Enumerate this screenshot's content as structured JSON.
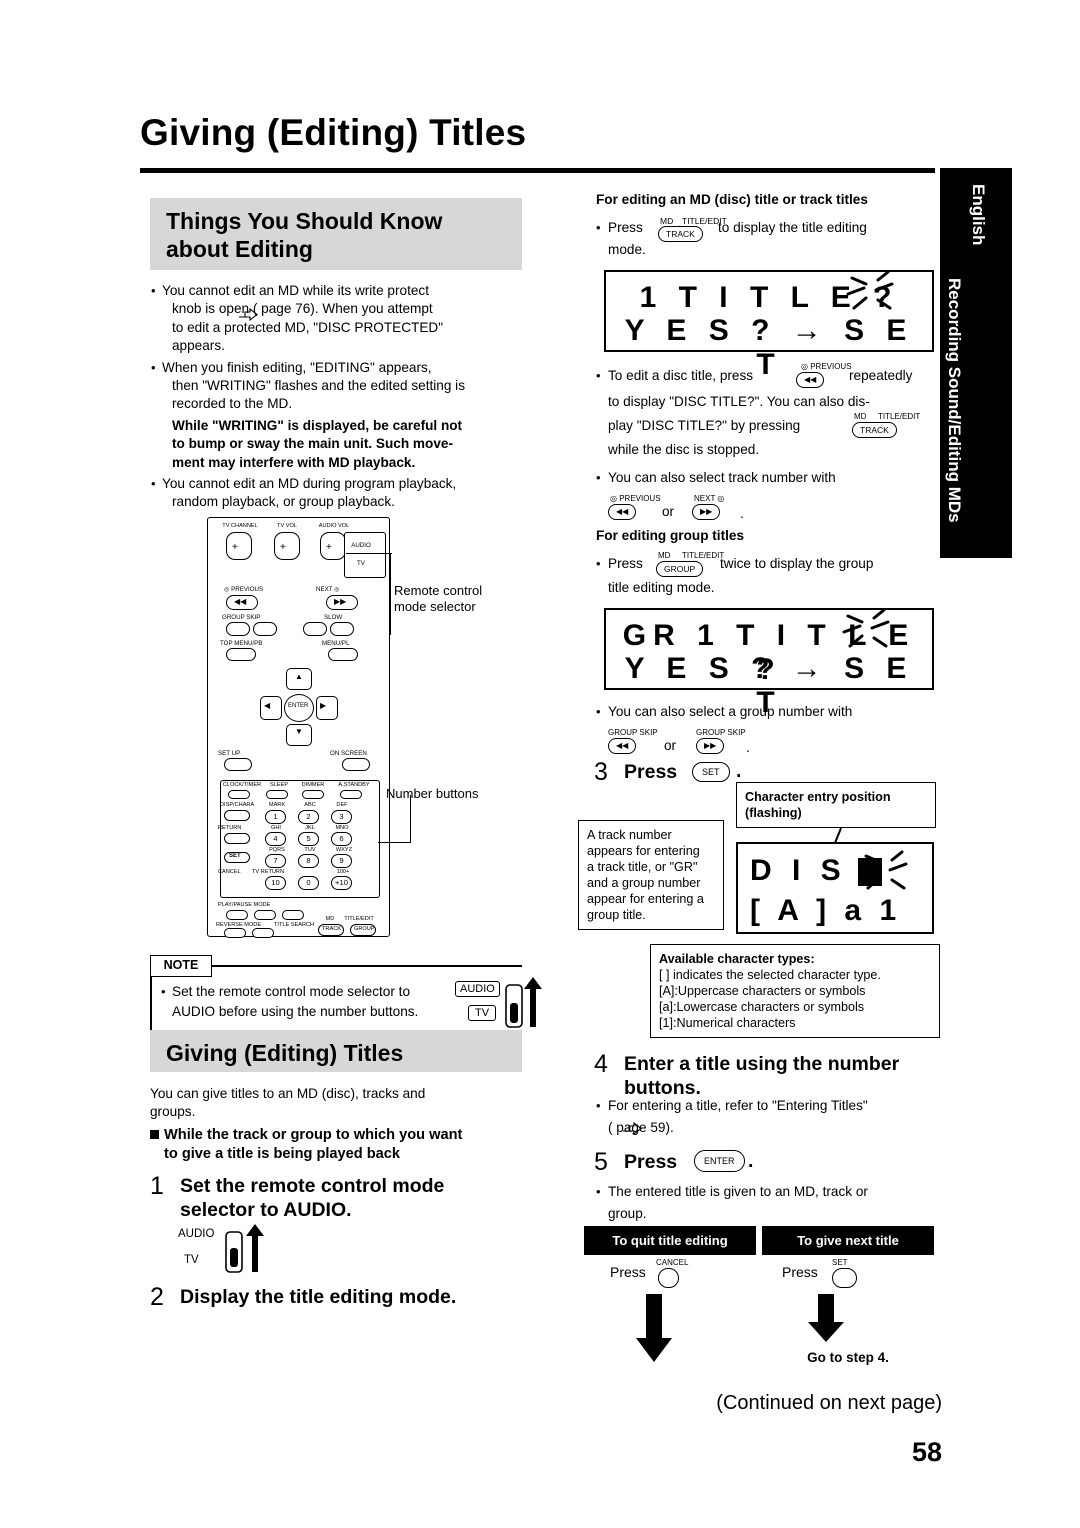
{
  "page": {
    "title": "Giving (Editing) Titles",
    "number": "58",
    "continued": "(Continued on next page)"
  },
  "side_tab": {
    "language": "English",
    "section": "Recording Sound/Editing MDs"
  },
  "left": {
    "heading1_line1": "Things You Should Know",
    "heading1_line2": "about Editing",
    "bullets": [
      "You cannot edit an MD while its write protect",
      "knob is open (       page 76). When you attempt",
      "to edit a protected MD, \"DISC PROTECTED\"",
      "appears.",
      "When you finish editing, \"EDITING\" appears,",
      "then \"WRITING\" flashes and the edited setting is",
      "recorded to the MD.",
      "While \"WRITING\" is displayed, be careful not",
      "to bump or sway the main unit. Such move-",
      "ment may interfere with MD playback.",
      "You cannot edit an MD during program playback,",
      "random playback, or group playback."
    ],
    "callout_remote_mode": "Remote control\nmode selector",
    "callout_number_buttons": "Number buttons",
    "note_tag": "NOTE",
    "note_text_1": "Set the remote control mode selector to",
    "note_text_2": "AUDIO before using the number buttons.",
    "note_audio": "AUDIO",
    "note_tv": "TV",
    "heading2": "Giving (Editing) Titles",
    "intro_1": "You can give titles to an MD (disc), tracks and",
    "intro_2": "groups.",
    "square_line1": "While the track or group to which you want",
    "square_line2": "to give a title is being played back",
    "step1_num": "1",
    "step1_text_1": "Set the remote control mode",
    "step1_text_2": "selector to AUDIO.",
    "step1_audio": "AUDIO",
    "step1_tv": "TV",
    "step2_num": "2",
    "step2_text": "Display the title editing mode."
  },
  "remote": {
    "labels": {
      "tv_channel": "TV CHANNEL",
      "tv_vol": "TV VOL",
      "audio_vol": "AUDIO VOL",
      "audio": "AUDIO",
      "tv": "TV",
      "previous": "PREVIOUS",
      "next": "NEXT",
      "group_skip": "GROUP SKIP",
      "slow": "SLOW",
      "top_menu_pb": "TOP MENU/PB",
      "menu_pl": "MENU/PL",
      "enter": "ENTER",
      "set_up": "SET UP",
      "on_screen": "ON SCREEN",
      "clock_timer": "CLOCK/TIMER",
      "sleep": "SLEEP",
      "dimmer": "DIMMER",
      "a_standby": "A.STANDBY",
      "disp_chara": "DISP/CHARA",
      "mark": "MARK",
      "abc": "ABC",
      "def": "DEF",
      "return": "RETURN",
      "ghi": "GHI",
      "jkl": "JKL",
      "mno": "MNO",
      "set": "SET",
      "pqrs": "PQRS",
      "tuv": "TUV",
      "wxyz": "WXYZ",
      "cancel": "CANCEL",
      "tv_return": "TV RETURN",
      "plus100": "100+",
      "play_pause_mode": "PLAY/PAUSE MODE",
      "reverse_mode": "REVERSE MODE",
      "title_search": "TITLE SEARCH",
      "md": "MD",
      "title_edit": "TITLE/EDIT",
      "track": "TRACK",
      "group": "GROUP"
    },
    "numbers": [
      "1",
      "2",
      "3",
      "4",
      "5",
      "6",
      "7",
      "8",
      "9",
      "10",
      "0",
      "+10"
    ]
  },
  "right": {
    "head1": "For editing an MD (disc) title or track titles",
    "b1_press": "Press",
    "b1_key_top": "MD",
    "b1_key_top2": "TITLE/EDIT",
    "b1_key": "TRACK",
    "b1_rest": "to display the title editing",
    "b1_rest2": "mode.",
    "lcd1_line1": "1 T I T L E ?",
    "lcd1_line2": "Y E S ? → S E T",
    "b2_l1": "To edit a disc title, press",
    "b2_key": "PREVIOUS",
    "b2_l1b": "repeatedly",
    "b2_l2": "to display \"DISC TITLE?\". You can also dis-",
    "b2_l3": "play \"DISC TITLE?\" by pressing",
    "b2_l4": "while the disc is stopped.",
    "b3_l1": "You can also select track number with",
    "b3_or": "or",
    "b3_prev": "PREVIOUS",
    "b3_next": "NEXT",
    "head2": "For editing group titles",
    "b4_press": "Press",
    "b4_rest": "twice to display the group",
    "b4_rest2": "title editing mode.",
    "lcd2_line1": "GR 1 T I T L E ?",
    "lcd2_line2": "Y E S ? → S E T",
    "b5_l1": "You can also select a group number with",
    "b5_gs": "GROUP SKIP",
    "b5_or": "or",
    "step3_num": "3",
    "step3_text": "Press",
    "step3_key": "SET",
    "step3_period": ".",
    "callout_char_pos_1": "Character entry position",
    "callout_char_pos_2": "(flashing)",
    "callout_track_1": "A track number",
    "callout_track_2": "appears for entering",
    "callout_track_3": "a track title, or \"GR\"",
    "callout_track_4": "and a group number",
    "callout_track_5": "appear for entering a",
    "callout_track_6": "group title.",
    "lcd3_line1": "D I S C",
    "lcd3_line2": "[ A ] a 1",
    "chartypes_head": "Available character types:",
    "chartypes": [
      "[ ] indicates the selected character type.",
      "[A]:Uppercase characters or symbols",
      "[a]:Lowercase characters or symbols",
      "[1]:Numerical characters"
    ],
    "step4_num": "4",
    "step4_text_1": "Enter a title using the number",
    "step4_text_2": "buttons.",
    "step4_b1": "For entering a title, refer to \"Entering Titles\"",
    "step4_b2": "(       page 59).",
    "step5_num": "5",
    "step5_text": "Press",
    "step5_key": "ENTER",
    "step5_period": ".",
    "step5_b1": "The entered title is given to an MD, track or",
    "step5_b2": "group.",
    "quit_box": "To quit title editing",
    "next_box": "To give next title",
    "quit_press": "Press",
    "quit_key": "CANCEL",
    "next_press": "Press",
    "next_key": "SET",
    "goto_step": "Go to step 4."
  }
}
